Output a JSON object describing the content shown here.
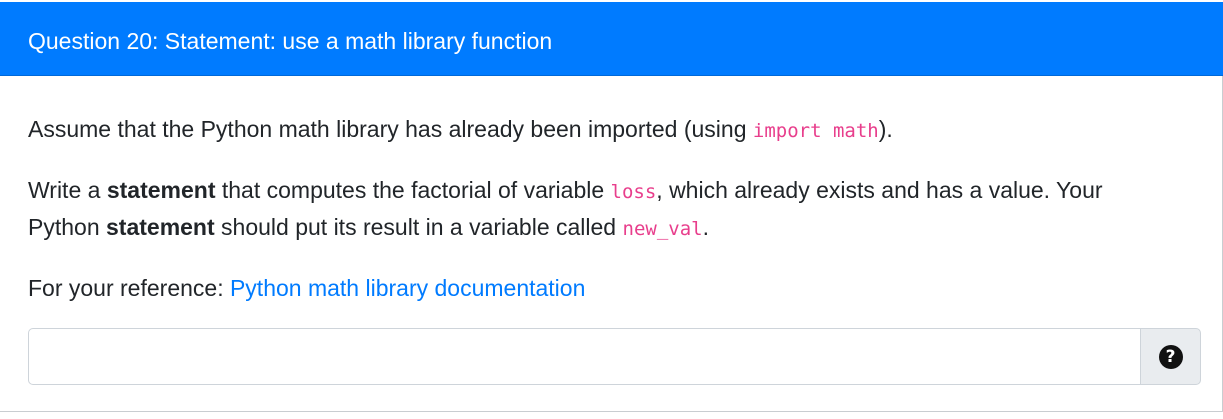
{
  "header": {
    "title": "Question 20: Statement: use a math library function"
  },
  "body": {
    "p1": {
      "before": "Assume that the Python math library has already been imported (using ",
      "code": "import math",
      "after": ")."
    },
    "p2": {
      "t1": "Write a ",
      "b1": "statement",
      "t2": " that computes the factorial of variable ",
      "code1": "loss",
      "t3": ", which already exists and has a value. Your",
      "t4": "Python ",
      "b2": "statement",
      "t5": " should put its result in a variable called ",
      "code2": "new_val",
      "t6": "."
    },
    "p3": {
      "label": "For your reference: ",
      "link": "Python math library documentation"
    }
  },
  "answer": {
    "value": "",
    "placeholder": ""
  },
  "help": {
    "icon": "question-circle-icon",
    "glyph": "?"
  },
  "colors": {
    "header_bg": "#007bff",
    "code": "#e83e8c",
    "link": "#007bff"
  }
}
